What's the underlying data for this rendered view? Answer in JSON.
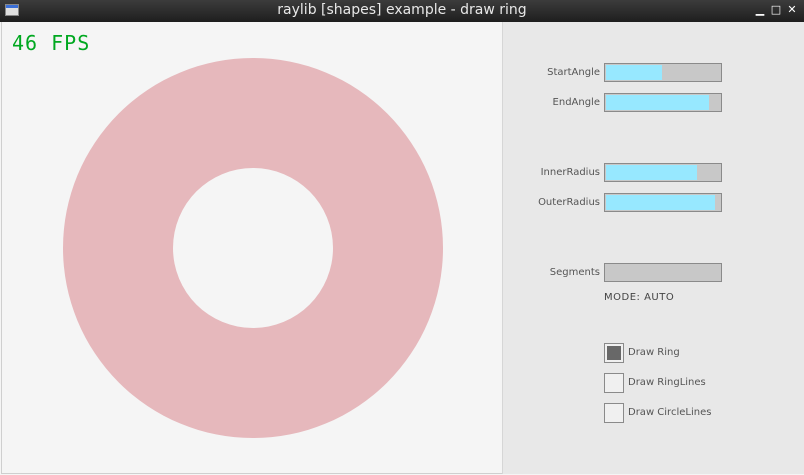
{
  "window": {
    "title": "raylib [shapes] example - draw ring",
    "minimize_glyph": "▁",
    "maximize_glyph": "□",
    "close_glyph": "✕"
  },
  "fps": "46 FPS",
  "ring": {
    "color": "#e6b8bc",
    "inner_color": "#f5f5f5"
  },
  "controls": {
    "start_angle": {
      "label": "StartAngle",
      "value": 0.49
    },
    "end_angle": {
      "label": "EndAngle",
      "value": 0.9
    },
    "inner_radius": {
      "label": "InnerRadius",
      "value": 0.8
    },
    "outer_radius": {
      "label": "OuterRadius",
      "value": 0.96
    },
    "segments": {
      "label": "Segments",
      "value": 0.0
    },
    "mode": "MODE: AUTO"
  },
  "checkboxes": [
    {
      "label": "Draw Ring",
      "checked": true
    },
    {
      "label": "Draw RingLines",
      "checked": false
    },
    {
      "label": "Draw CircleLines",
      "checked": false
    }
  ]
}
